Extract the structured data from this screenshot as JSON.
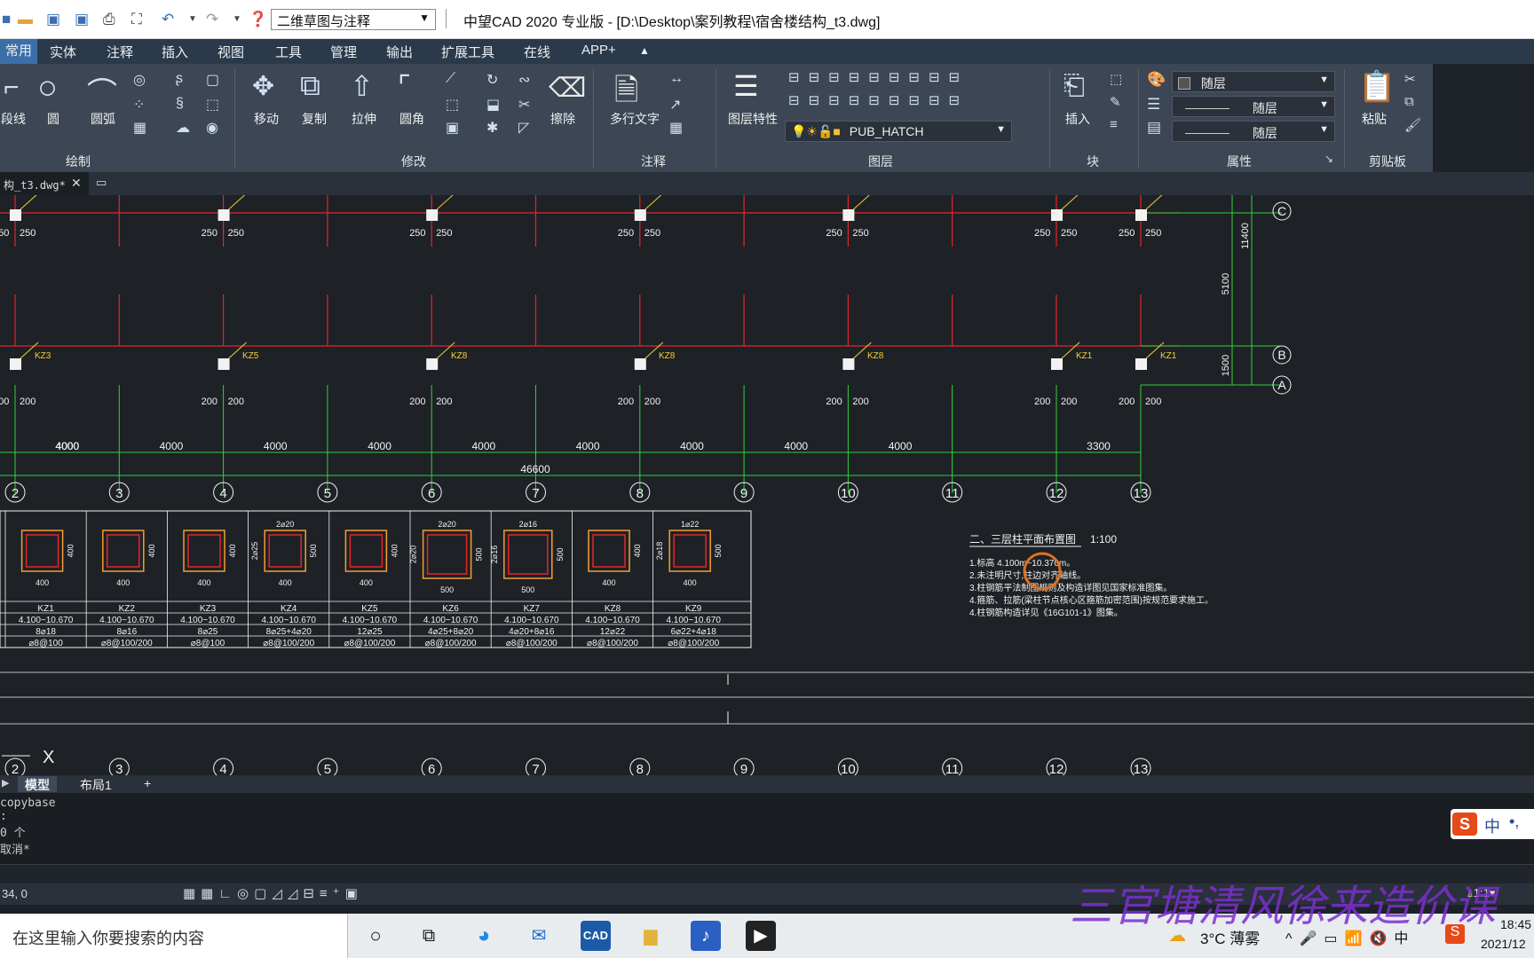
{
  "titlebar": {
    "workspace": "二维草图与注释",
    "title": "中望CAD 2020 专业版 - [D:\\Desktop\\案列教程\\宿舍楼结构_t3.dwg]"
  },
  "menu": {
    "tabs": [
      "常用",
      "实体",
      "注释",
      "插入",
      "视图",
      "工具",
      "管理",
      "输出",
      "扩展工具",
      "在线",
      "APP+"
    ]
  },
  "ribbon": {
    "draw": {
      "label": "绘制",
      "polyline": "段线",
      "circle": "圆",
      "arc": "圆弧"
    },
    "modify": {
      "label": "修改",
      "move": "移动",
      "copy": "复制",
      "stretch": "拉伸",
      "fillet": "圆角",
      "erase": "擦除"
    },
    "annotate": {
      "label": "注释",
      "mtext": "多行文字"
    },
    "layers": {
      "label": "图层",
      "props": "图层特性",
      "current_layer": "PUB_HATCH"
    },
    "block": {
      "label": "块",
      "insert": "插入"
    },
    "properties": {
      "label": "属性",
      "color": "随层",
      "linetype": "随层",
      "lineweight": "随层"
    },
    "clipboard": {
      "label": "剪贴板",
      "paste": "粘贴"
    }
  },
  "doctab": {
    "name": "构_t3.dwg*"
  },
  "drawing": {
    "spans": [
      "4000",
      "4000",
      "4000",
      "4000",
      "4000",
      "4000",
      "4000",
      "4000",
      "4000",
      "4000",
      "3300"
    ],
    "total": "46600",
    "axes": [
      "2",
      "3",
      "4",
      "5",
      "6",
      "7",
      "8",
      "9",
      "10",
      "11",
      "12",
      "13"
    ],
    "rows": [
      "C",
      "B",
      "A"
    ],
    "dims_right": {
      "cb": "5100",
      "ba": "1500",
      "total": "11400"
    },
    "col_labels_row": [
      "KZ3",
      "KZ5",
      "KZ8",
      "KZ8",
      "KZ8",
      "KZ1",
      "KZ1"
    ],
    "table": {
      "cols": [
        {
          "name": "KZ1",
          "h": "400",
          "w": "400",
          "top": "",
          "side": "",
          "elev": "4.100~10.670",
          "bar": "8⌀18",
          "stir": "⌀8@100"
        },
        {
          "name": "KZ2",
          "h": "400",
          "w": "400",
          "top": "",
          "side": "",
          "elev": "4.100~10.670",
          "bar": "8⌀16",
          "stir": "⌀8@100/200"
        },
        {
          "name": "KZ3",
          "h": "400",
          "w": "400",
          "top": "",
          "side": "",
          "elev": "4.100~10.670",
          "bar": "8⌀25",
          "stir": "⌀8@100"
        },
        {
          "name": "KZ4",
          "h": "500",
          "w": "400",
          "top": "2⌀20",
          "side": "2⌀25",
          "elev": "4.100~10.670",
          "bar": "8⌀25+4⌀20",
          "stir": "⌀8@100/200"
        },
        {
          "name": "KZ5",
          "h": "400",
          "w": "400",
          "top": "",
          "side": "",
          "elev": "4.100~10.670",
          "bar": "12⌀25",
          "stir": "⌀8@100/200"
        },
        {
          "name": "KZ6",
          "h": "500",
          "w": "500",
          "top": "2⌀20",
          "side": "2⌀20",
          "elev": "4.100~10.670",
          "bar": "4⌀25+8⌀20",
          "stir": "⌀8@100/200"
        },
        {
          "name": "KZ7",
          "h": "500",
          "w": "500",
          "top": "2⌀16",
          "side": "2⌀16",
          "elev": "4.100~10.670",
          "bar": "4⌀20+8⌀16",
          "stir": "⌀8@100/200"
        },
        {
          "name": "KZ8",
          "h": "400",
          "w": "400",
          "top": "",
          "side": "",
          "elev": "4.100~10.670",
          "bar": "12⌀22",
          "stir": "⌀8@100/200"
        },
        {
          "name": "KZ9",
          "h": "500",
          "w": "400",
          "top": "1⌀22",
          "side": "2⌀18",
          "elev": "4.100~10.670",
          "bar": "6⌀22+4⌀18",
          "stir": "⌀8@100/200"
        }
      ]
    },
    "note_title": "二、三层柱平面布置图",
    "note_scale": "1:100",
    "notes": [
      "1.标高 4.100m~10.370m。",
      "2.未注明尺寸,柱边对齐轴线。",
      "3.柱钢筋平法制图规则及构造详图见国家标准图集。",
      "4.箍筋、拉筋(梁柱节点核心区箍筋加密范围)按规范要求施工。",
      "4.柱钢筋构造详见《16G101-1》图集。"
    ]
  },
  "layouttabs": [
    "模型",
    "布局1",
    "+"
  ],
  "cmd": {
    "lines": [
      "copybase",
      ":",
      "0 个",
      "取消*"
    ]
  },
  "status": {
    "coords": "34, 0"
  },
  "taskbar": {
    "search": "在这里输入你要搜索的内容",
    "weather": "3°C 薄雾",
    "time": "18:45",
    "date": "2021/12"
  },
  "ime": {
    "label": "中"
  },
  "watermark": "三官塘清风徐来造价课"
}
